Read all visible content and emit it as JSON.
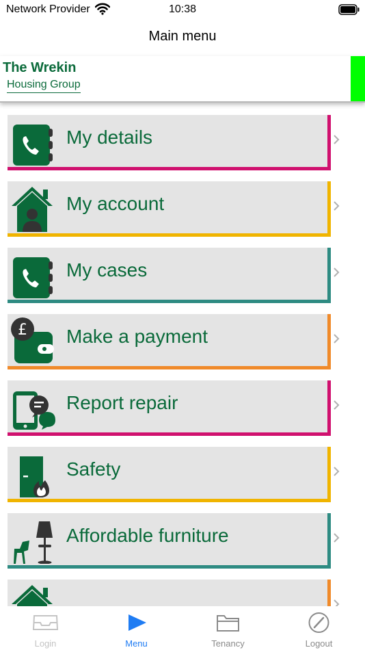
{
  "status_bar": {
    "carrier": "Network Provider",
    "time": "10:38"
  },
  "nav": {
    "title": "Main menu"
  },
  "brand": {
    "name": "The Wrekin",
    "sub": "Housing Group",
    "color": "#0a6a3a",
    "accent_color": "#00ff00"
  },
  "menu": {
    "items": [
      {
        "label": "My details",
        "icon": "phone-book-icon",
        "border_color": "#d0106e"
      },
      {
        "label": "My account",
        "icon": "house-person-icon",
        "border_color": "#f0b400"
      },
      {
        "label": "My cases",
        "icon": "phone-book-icon",
        "border_color": "#2e8b82"
      },
      {
        "label": "Make a payment",
        "icon": "wallet-pound-icon",
        "border_color": "#f08a2a"
      },
      {
        "label": "Report repair",
        "icon": "phone-chat-icon",
        "border_color": "#d0106e"
      },
      {
        "label": "Safety",
        "icon": "fire-door-icon",
        "border_color": "#f0b400"
      },
      {
        "label": "Affordable furniture",
        "icon": "furniture-icon",
        "border_color": "#2e8b82"
      },
      {
        "label": "",
        "icon": "house-icon",
        "border_color": "#f08a2a"
      }
    ]
  },
  "tabs": [
    {
      "label": "Login",
      "icon": "tray-icon",
      "color": "#c4c4c4"
    },
    {
      "label": "Menu",
      "icon": "play-icon",
      "color": "#1f7cf3"
    },
    {
      "label": "Tenancy",
      "icon": "folder-icon",
      "color": "#8a8a8a"
    },
    {
      "label": "Logout",
      "icon": "compass-icon",
      "color": "#8a8a8a"
    }
  ]
}
